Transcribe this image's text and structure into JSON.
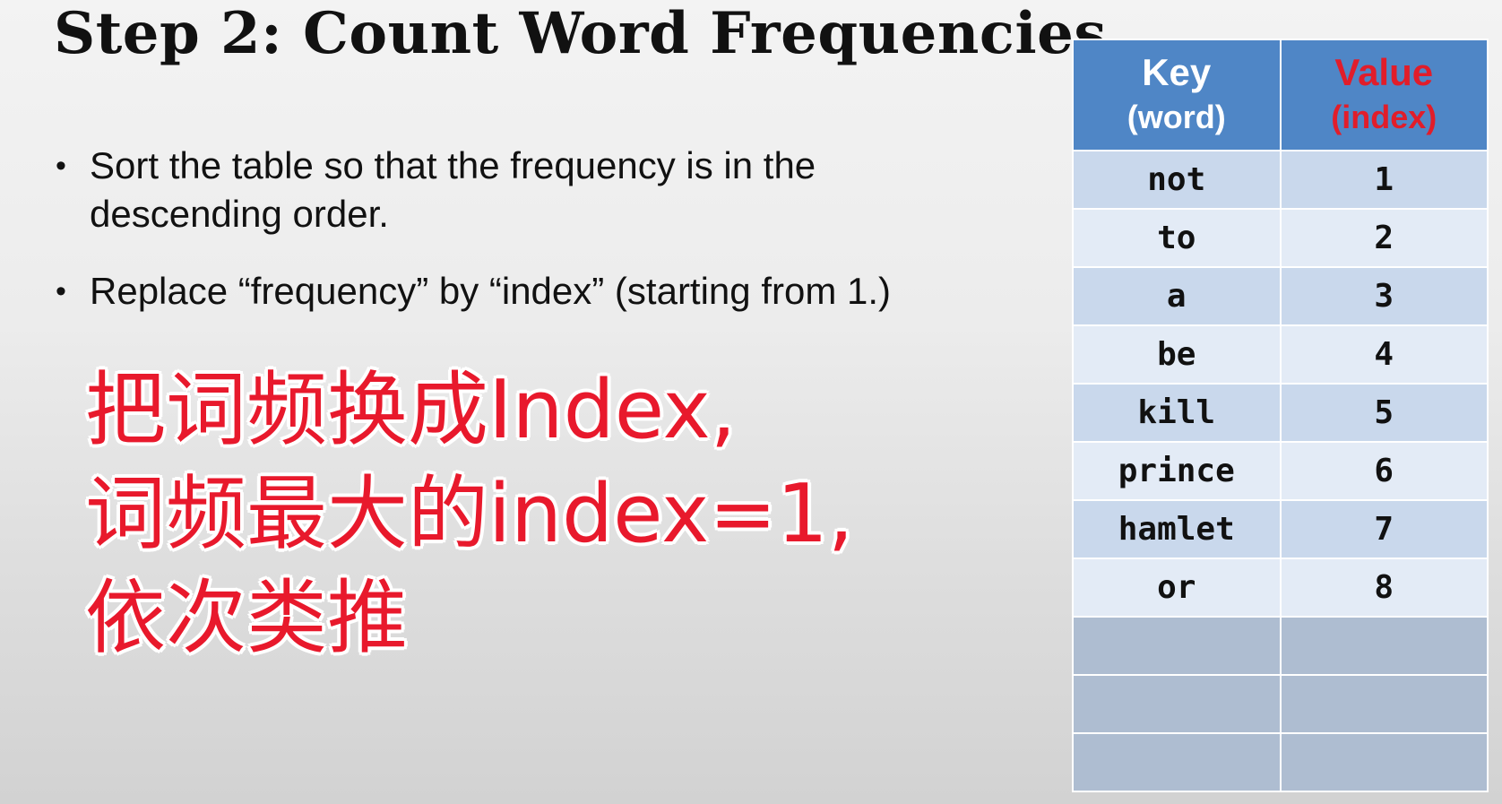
{
  "slide": {
    "title": "Step 2: Count Word Frequencies",
    "bullets": [
      "Sort the table so that the frequency is in the descending order.",
      "Replace “frequency” by “index” (starting from 1.)"
    ],
    "subtitle_overlay": "把词频换成Index,\n词频最大的index=1,\n依次类推"
  },
  "table": {
    "key_header": "Key",
    "key_subheader": "(word)",
    "value_header": "Value",
    "value_subheader": "(index)",
    "rows": [
      {
        "key": "not",
        "value": "1"
      },
      {
        "key": "to",
        "value": "2"
      },
      {
        "key": "a",
        "value": "3"
      },
      {
        "key": "be",
        "value": "4"
      },
      {
        "key": "kill",
        "value": "5"
      },
      {
        "key": "prince",
        "value": "6"
      },
      {
        "key": "hamlet",
        "value": "7"
      },
      {
        "key": "or",
        "value": "8"
      }
    ],
    "empty_rows": 3
  },
  "colors": {
    "header_bg": "#4f86c6",
    "value_header_text": "#e11d2a",
    "subtitle_text": "#e8192c"
  }
}
